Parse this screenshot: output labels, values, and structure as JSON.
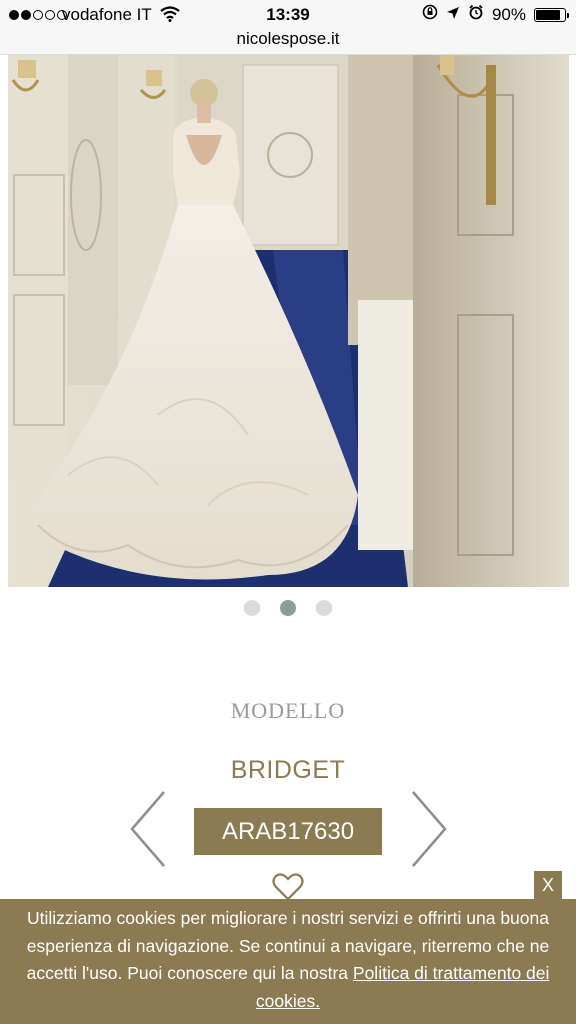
{
  "status_bar": {
    "carrier": "vodafone IT",
    "time": "13:39",
    "battery_percent": "90%",
    "signal_bars_filled": 2,
    "signal_bars_total": 5,
    "battery_level": 0.9
  },
  "url_bar": {
    "domain": "nicolespose.it"
  },
  "gallery": {
    "slide_count": 3,
    "active_slide": 2
  },
  "product": {
    "caption": "MODELLO",
    "name": "BRIDGET",
    "code": "ARAB17630"
  },
  "colors": {
    "brand": "#8b7a52",
    "dot_active": "#8f9b9a",
    "dot_inactive": "#d8dcdc"
  },
  "cookie_banner": {
    "text": "Utilizziamo cookies per migliorare i nostri servizi e offrirti una buona esperienza di navigazione. Se continui a navigare, riterremo che ne accetti l'uso. Puoi conoscere qui la nostra",
    "link_label": "Politica di trattamento dei cookies.",
    "close_label": "X"
  }
}
